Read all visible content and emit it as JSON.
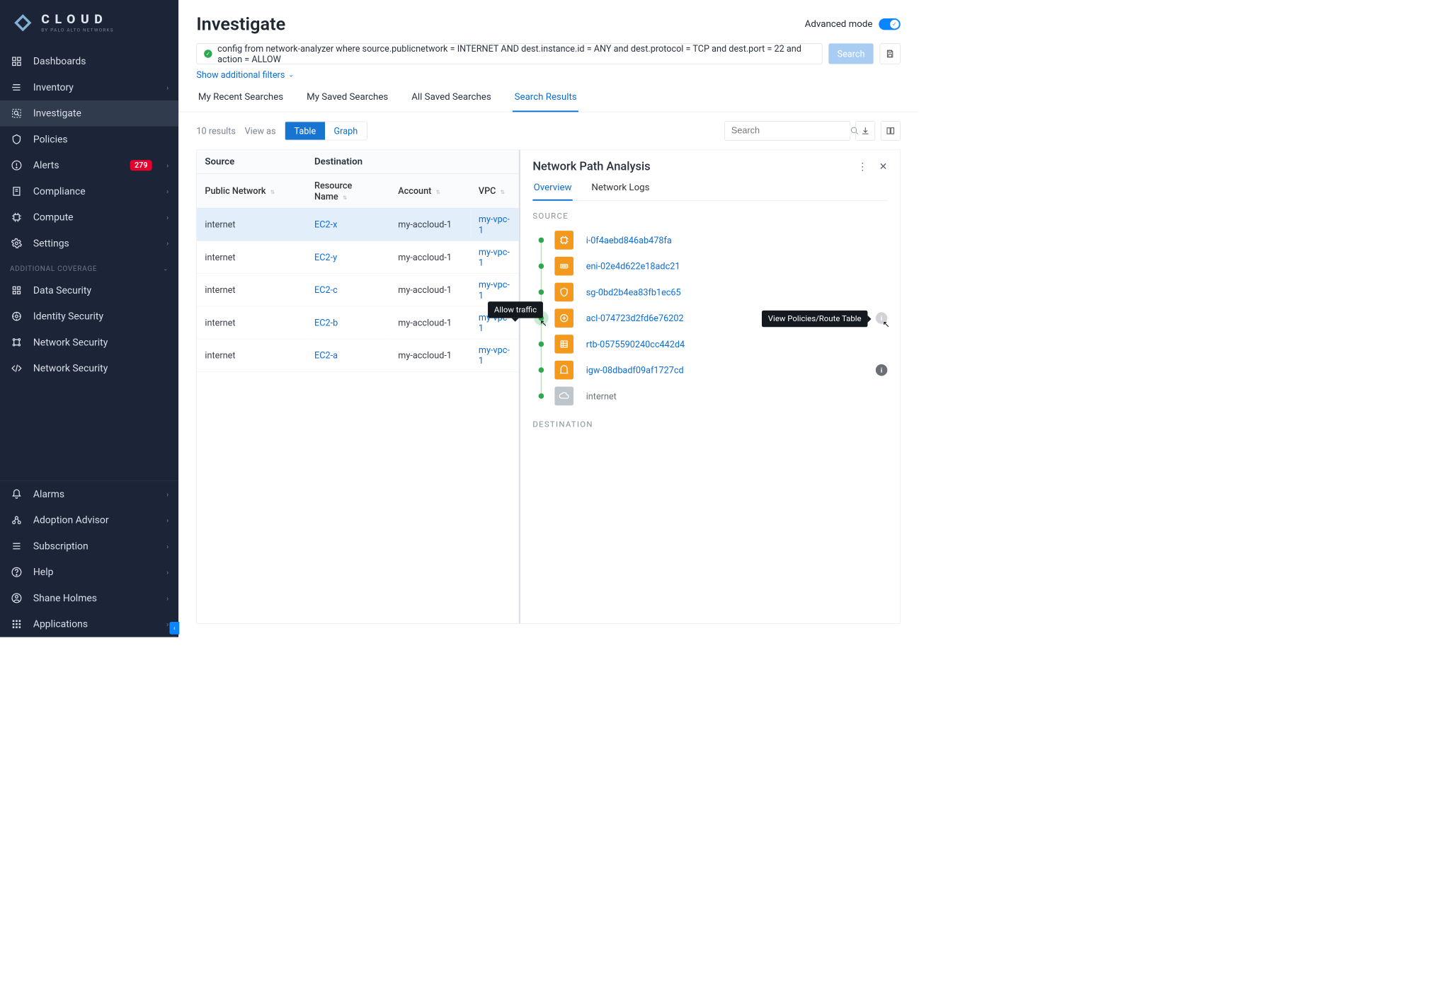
{
  "brand": {
    "line1": "CLOUD",
    "line2": "BY PALO ALTO NETWORKS"
  },
  "sidebar": {
    "items": [
      {
        "label": "Dashboards"
      },
      {
        "label": "Inventory"
      },
      {
        "label": "Investigate"
      },
      {
        "label": "Policies"
      },
      {
        "label": "Alerts",
        "badge": "279"
      },
      {
        "label": "Compliance"
      },
      {
        "label": "Compute"
      },
      {
        "label": "Settings"
      }
    ],
    "additional": {
      "header": "ADDITIONAL COVERAGE",
      "items": [
        {
          "label": "Data Security"
        },
        {
          "label": "Identity Security"
        },
        {
          "label": "Network Security"
        },
        {
          "label": "Network Security"
        }
      ]
    },
    "bottom": [
      {
        "label": "Alarms"
      },
      {
        "label": "Adoption Advisor"
      },
      {
        "label": "Subscription"
      },
      {
        "label": "Help"
      },
      {
        "label": "Shane Holmes"
      },
      {
        "label": "Applications"
      }
    ]
  },
  "header": {
    "title": "Investigate",
    "advanced_label": "Advanced mode"
  },
  "query": {
    "text": "config from network-analyzer where source.publicnetwork = INTERNET AND dest.instance.id = ANY and dest.protocol = TCP and dest.port = 22 and action = ALLOW",
    "search_btn": "Search",
    "filters_link": "Show additional filters"
  },
  "tabs": [
    {
      "label": "My Recent Searches"
    },
    {
      "label": "My Saved Searches"
    },
    {
      "label": "All Saved Searches"
    },
    {
      "label": "Search Results"
    }
  ],
  "toolbar": {
    "results": "10 results",
    "viewas": "View as",
    "seg_table": "Table",
    "seg_graph": "Graph",
    "search_placeholder": "Search"
  },
  "table": {
    "group_source": "Source",
    "group_dest": "Destination",
    "col_publicnet": "Public Network",
    "col_resource": "Resource Name",
    "col_account": "Account",
    "col_vpc": "VPC",
    "rows": [
      {
        "src": "internet",
        "res": "EC2-x",
        "acct": "my-accloud-1",
        "vpc": "my-vpc-1"
      },
      {
        "src": "internet",
        "res": "EC2-y",
        "acct": "my-accloud-1",
        "vpc": "my-vpc-1"
      },
      {
        "src": "internet",
        "res": "EC2-c",
        "acct": "my-accloud-1",
        "vpc": "my-vpc-1"
      },
      {
        "src": "internet",
        "res": "EC2-b",
        "acct": "my-accloud-1",
        "vpc": "my-vpc-1"
      },
      {
        "src": "internet",
        "res": "EC2-a",
        "acct": "my-accloud-1",
        "vpc": "my-vpc-1"
      }
    ]
  },
  "panel": {
    "title": "Network Path Analysis",
    "tab_overview": "Overview",
    "tab_logs": "Network Logs",
    "label_source": "SOURCE",
    "label_dest": "DESTINATION",
    "hops": [
      {
        "label": "i-0f4aebd846ab478fa",
        "type": "instance"
      },
      {
        "label": "eni-02e4d622e18adc21",
        "type": "eni"
      },
      {
        "label": "sg-0bd2b4ea83fb1ec65",
        "type": "sg"
      },
      {
        "label": "acl-074723d2fd6e76202",
        "type": "acl"
      },
      {
        "label": "rtb-0575590240cc442d4",
        "type": "rtb"
      },
      {
        "label": "igw-08dbadf09af1727cd",
        "type": "igw"
      },
      {
        "label": "internet",
        "type": "internet"
      }
    ],
    "tooltip_allow": "Allow traffic",
    "tooltip_policies": "View Policies/Route Table"
  }
}
